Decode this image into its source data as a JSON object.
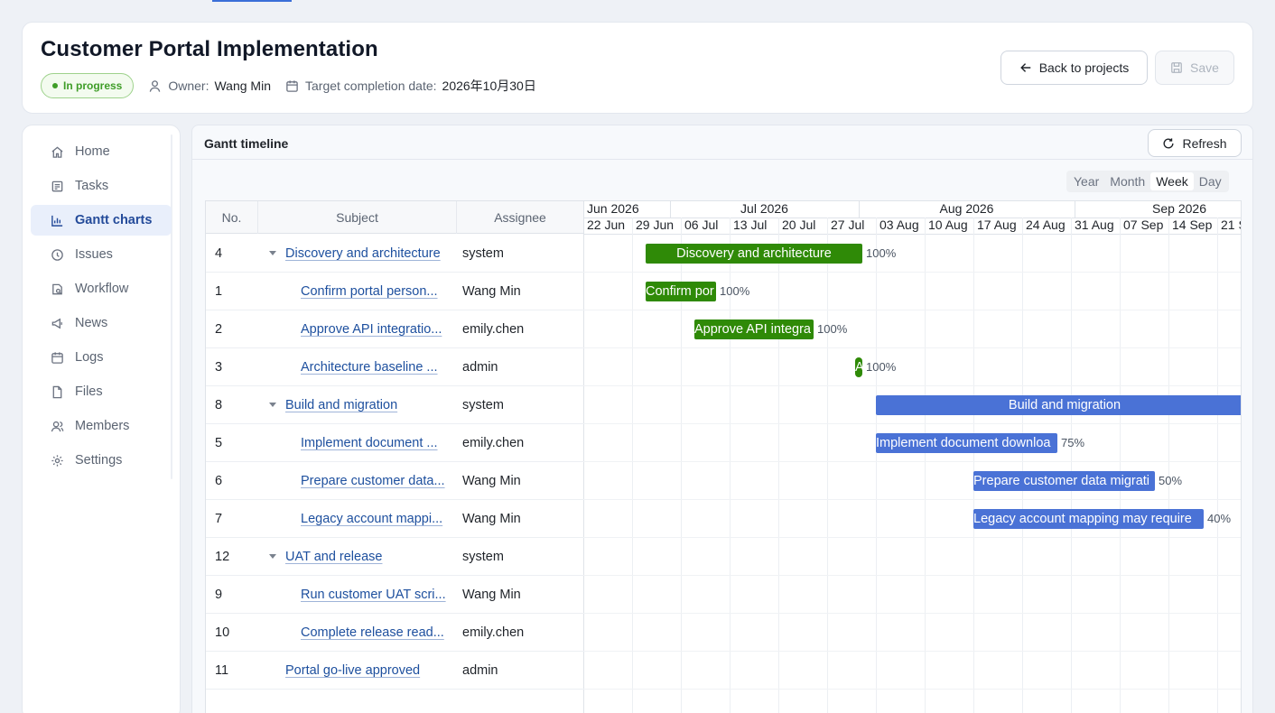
{
  "header": {
    "title": "Customer Portal Implementation",
    "status": "In progress",
    "owner_label": "Owner:",
    "owner": "Wang Min",
    "target_label": "Target completion date:",
    "target_date": "2026年10月30日",
    "back_label": "Back to projects",
    "save_label": "Save"
  },
  "sidebar": {
    "items": [
      {
        "label": "Home",
        "icon": "home-icon"
      },
      {
        "label": "Tasks",
        "icon": "tasks-icon"
      },
      {
        "label": "Gantt charts",
        "icon": "chart-icon",
        "active": true
      },
      {
        "label": "Issues",
        "icon": "issues-icon"
      },
      {
        "label": "Workflow",
        "icon": "workflow-icon"
      },
      {
        "label": "News",
        "icon": "news-icon"
      },
      {
        "label": "Logs",
        "icon": "calendar-icon"
      },
      {
        "label": "Files",
        "icon": "file-icon"
      },
      {
        "label": "Members",
        "icon": "members-icon"
      },
      {
        "label": "Settings",
        "icon": "gear-icon"
      }
    ]
  },
  "gantt": {
    "title": "Gantt timeline",
    "refresh_label": "Refresh",
    "scales": [
      "Year",
      "Month",
      "Week",
      "Day"
    ],
    "active_scale": "Week",
    "columns": {
      "no": "No.",
      "subject": "Subject",
      "assignee": "Assignee"
    },
    "months": [
      "Jun 2026",
      "Jul 2026",
      "Aug 2026",
      "Sep 2026"
    ],
    "weeks": [
      "22 Jun",
      "29 Jun",
      "06 Jul",
      "13 Jul",
      "20 Jul",
      "27 Jul",
      "03 Aug",
      "10 Aug",
      "17 Aug",
      "24 Aug",
      "31 Aug",
      "07 Sep",
      "14 Sep",
      "21 S"
    ],
    "rows": [
      {
        "no": "4",
        "subject": "Discovery and architecture",
        "assignee": "system",
        "parent": true,
        "bar_label": "Discovery and architecture",
        "progress": "100%",
        "color": "#2f8a07"
      },
      {
        "no": "1",
        "subject": "Confirm portal person...",
        "assignee": "Wang Min",
        "bar_label": "Confirm por",
        "progress": "100%",
        "color": "#2f8a07"
      },
      {
        "no": "2",
        "subject": "Approve API integratio...",
        "assignee": "emily.chen",
        "bar_label": "Approve API integra",
        "progress": "100%",
        "color": "#2f8a07"
      },
      {
        "no": "3",
        "subject": "Architecture baseline ...",
        "assignee": "admin",
        "bar_label": "A",
        "progress": "100%",
        "color": "#2f8a07"
      },
      {
        "no": "8",
        "subject": "Build and migration",
        "assignee": "system",
        "parent": true,
        "bar_label": "Build and migration",
        "progress": "",
        "color": "#4a72d6"
      },
      {
        "no": "5",
        "subject": "Implement document ...",
        "assignee": "emily.chen",
        "bar_label": "Implement document downloa",
        "progress": "75%",
        "color": "#4a72d6"
      },
      {
        "no": "6",
        "subject": "Prepare customer data...",
        "assignee": "Wang Min",
        "bar_label": "Prepare customer data migrati",
        "progress": "50%",
        "color": "#4a72d6"
      },
      {
        "no": "7",
        "subject": "Legacy account mappi...",
        "assignee": "Wang Min",
        "bar_label": "Legacy account mapping may require",
        "progress": "40%",
        "color": "#4a72d6"
      },
      {
        "no": "12",
        "subject": "UAT and release",
        "assignee": "system",
        "parent": true
      },
      {
        "no": "9",
        "subject": "Run customer UAT scri...",
        "assignee": "Wang Min"
      },
      {
        "no": "10",
        "subject": "Complete release read...",
        "assignee": "emily.chen"
      },
      {
        "no": "11",
        "subject": "Portal go-live approved",
        "assignee": "admin",
        "top_level": true
      }
    ]
  }
}
